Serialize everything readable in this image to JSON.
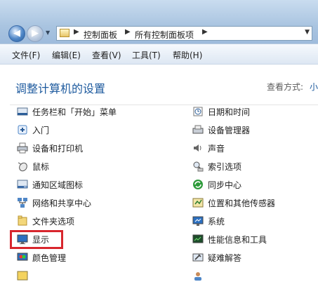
{
  "address_bar": {
    "breadcrumbs": [
      "控制面板",
      "所有控制面板项"
    ]
  },
  "menu": [
    "文件(F)",
    "编辑(E)",
    "查看(V)",
    "工具(T)",
    "帮助(H)"
  ],
  "page": {
    "title": "调整计算机的设置",
    "view_by_label": "查看方式:",
    "view_by_value": "小"
  },
  "items_left": [
    {
      "label": "任务栏和「开始」菜单",
      "icon": "taskbar-icon"
    },
    {
      "label": "入门",
      "icon": "getting-started-icon"
    },
    {
      "label": "设备和打印机",
      "icon": "printer-icon"
    },
    {
      "label": "鼠标",
      "icon": "mouse-icon"
    },
    {
      "label": "通知区域图标",
      "icon": "notification-icon"
    },
    {
      "label": "网络和共享中心",
      "icon": "network-icon"
    },
    {
      "label": "文件夹选项",
      "icon": "folder-options-icon"
    },
    {
      "label": "显示",
      "icon": "display-icon"
    },
    {
      "label": "颜色管理",
      "icon": "color-management-icon"
    }
  ],
  "items_right": [
    {
      "label": "日期和时间",
      "icon": "clock-icon"
    },
    {
      "label": "设备管理器",
      "icon": "device-manager-icon"
    },
    {
      "label": "声音",
      "icon": "speaker-icon"
    },
    {
      "label": "索引选项",
      "icon": "indexing-icon"
    },
    {
      "label": "同步中心",
      "icon": "sync-icon"
    },
    {
      "label": "位置和其他传感器",
      "icon": "sensor-icon"
    },
    {
      "label": "系统",
      "icon": "system-icon"
    },
    {
      "label": "性能信息和工具",
      "icon": "performance-icon"
    },
    {
      "label": "疑难解答",
      "icon": "troubleshooting-icon"
    }
  ],
  "highlighted_item": "显示",
  "colors": {
    "title_blue": "#1d5a9e",
    "highlight_red": "#d8262d"
  }
}
